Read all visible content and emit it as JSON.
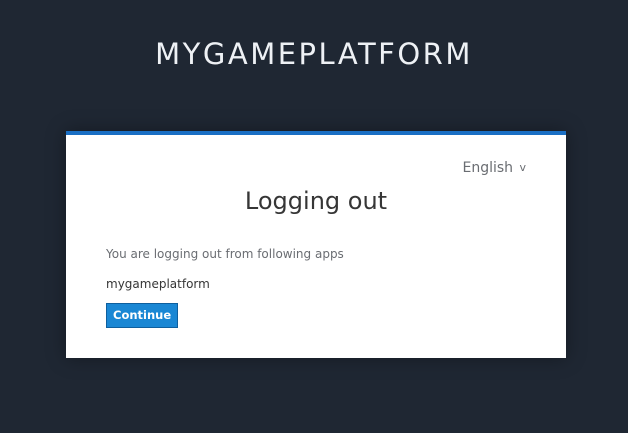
{
  "header": {
    "brand": "MYGAMEPLATFORM"
  },
  "card": {
    "language": {
      "selected": "English",
      "chevron_icon": "chevron-down-icon"
    },
    "title": "Logging out",
    "info_text": "You are logging out from following apps",
    "apps": [
      "mygameplatform"
    ],
    "continue_label": "Continue"
  },
  "colors": {
    "background": "#1f2733",
    "card_top_border": "#1a6fc4",
    "button": "#1a87d4"
  }
}
